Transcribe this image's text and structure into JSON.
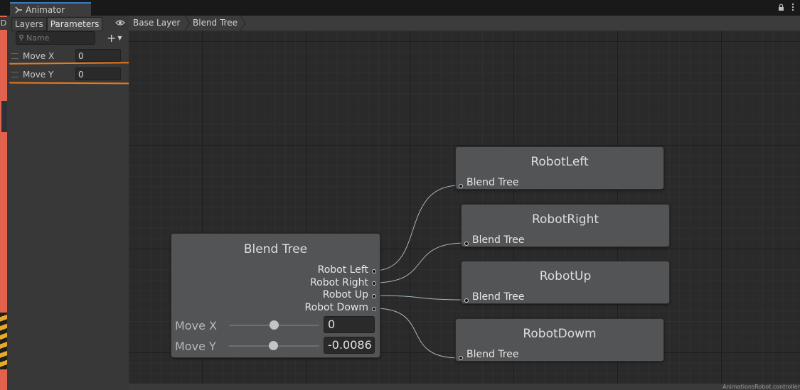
{
  "window": {
    "tab_title": "Animator",
    "lock_icon": "lock-icon",
    "menu_icon": "kebab-menu-icon"
  },
  "scene_strip": {
    "letter": "D"
  },
  "left_panel": {
    "tabs": [
      {
        "label": "Layers",
        "active": false
      },
      {
        "label": "Parameters",
        "active": true
      }
    ],
    "search_placeholder": "Name",
    "add_label": "+",
    "parameters": [
      {
        "name": "Move X",
        "value": "0"
      },
      {
        "name": "Move Y",
        "value": "0"
      }
    ]
  },
  "breadcrumb": [
    "Base Layer",
    "Blend Tree"
  ],
  "blend_tree": {
    "title": "Blend Tree",
    "outputs": [
      "Robot Left",
      "Robot Right",
      "Robot Up",
      "Robot Dowm"
    ],
    "sliders": [
      {
        "label": "Move X",
        "value": "0",
        "position": 0.5
      },
      {
        "label": "Move Y",
        "value": "-0.0086",
        "position": 0.49
      }
    ]
  },
  "motions": [
    {
      "title": "RobotLeft",
      "input": "Blend Tree"
    },
    {
      "title": "RobotRight",
      "input": "Blend Tree"
    },
    {
      "title": "RobotUp",
      "input": "Blend Tree"
    },
    {
      "title": "RobotDowm",
      "input": "Blend Tree"
    }
  ],
  "status": {
    "path": "AnimationsRobot.controller"
  },
  "colors": {
    "accent_tab": "#3a79bb",
    "annotation_underline": "#ea7a1e",
    "node": "#535456"
  }
}
